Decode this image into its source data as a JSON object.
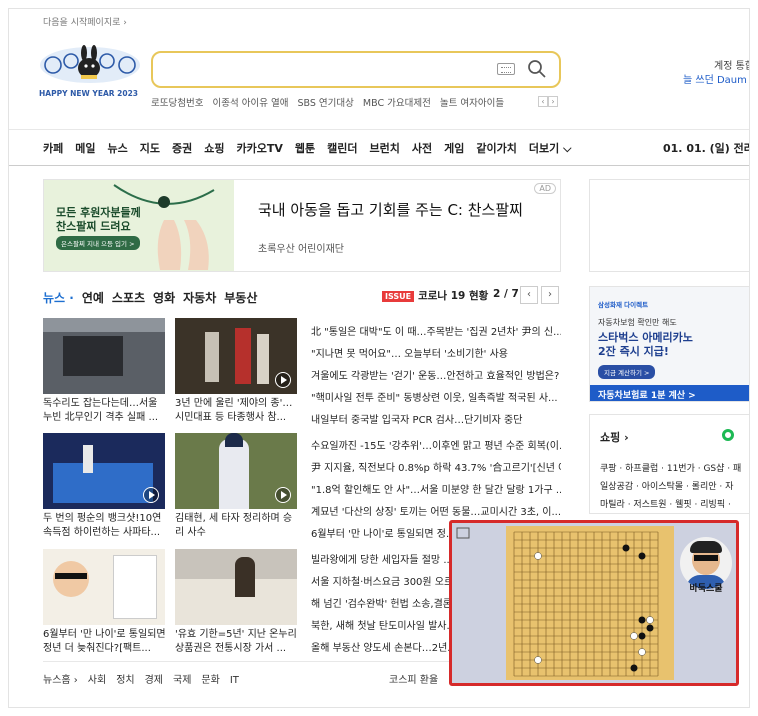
{
  "top": {
    "startpage": "다음을 시작페이지로 ›"
  },
  "logo": {
    "text": "HAPPY NEW YEAR 2023"
  },
  "search": {
    "placeholder": ""
  },
  "hot_keywords": [
    "로또당첨번호",
    "이종석 아이유 열애",
    "SBS 연기대상",
    "MBC 가요대제전",
    "놀트 여자아이들"
  ],
  "account": {
    "line1": "계정 통합",
    "line2": "늘 쓰던 Daum 계정"
  },
  "gnb": [
    "카페",
    "메일",
    "뉴스",
    "지도",
    "증권",
    "쇼핑",
    "카카오TV",
    "웹툰",
    "캘린더",
    "브런치",
    "사전",
    "게임",
    "같이가치",
    "더보기 ⌵"
  ],
  "date": "01. 01. (일)  전라",
  "ad": {
    "image_text_1": "모든 후원자분들께",
    "image_text_2": "찬스팔찌 드려요",
    "image_button": "은스팔찌 지내 으등 입기 >",
    "title": "국내 아동을 돕고 기회를 주는 C: 찬스팔찌",
    "sub": "초록우산 어린이재단",
    "badge": "AD"
  },
  "news_tabs": {
    "active": "뉴스 ·",
    "items": [
      "연예",
      "스포츠",
      "영화",
      "자동차",
      "부동산"
    ]
  },
  "issue": {
    "badge": "ISSUE",
    "text": "코로나 19 현황"
  },
  "pager": {
    "text": "2 / 7",
    "prev": "‹",
    "next": "›"
  },
  "cards": [
    {
      "caption": "독수리도 잡는다는데…서울 누빈 北무인기 격추 실패 ..."
    },
    {
      "caption": "3년 만에 울린 '제야의 종'… 시민대표 등 타종행사 참..."
    },
    {
      "caption": "두 번의 펑순의 뱅크샷!10연속득점 하이런하는 사파타..."
    },
    {
      "caption": "김태현, 세 타자 정리하며 승리 사수"
    },
    {
      "caption": "6월부터 '만 나이'로 통일되면 정년 더 늦춰진다?[팩트..."
    },
    {
      "caption": "'유효 기한=5년' 지난 온누리 상품권은 전통시장 가서 ..."
    }
  ],
  "headlines": [
    "北 \"통일은 대박\"도 이 때…주목받는 '집권 2년차' 尹의 신...",
    "\"지나면 못 먹어요\"… 오늘부터 '소비기한' 사용",
    "겨울에도 각광받는 '걷기' 운동…안전하고 효율적인 방법은?",
    "\"핵미사일 전투 준비\" 동병상련 이웃, 일촉즉발 적국된 사...",
    "내일부터 중국발 입국자 PCR 검사…단기비자 중단",
    "수요일까진 -15도 '강추위'…이후엔 맑고 평년 수준 회복(이...",
    "尹 지지율, 직전보다 0.8%p 하락 43.7% '合고르기'[신년 여...",
    "\"1.8억 할인해도 안 사\"…서울 미분양 한 달간 달랑 1가구 ...",
    "계묘년 '다산의 상징' 토끼는 어떤 동물…교미시간 3초, 이...",
    "6월부터 '만 나이'로 통일되면 정...",
    "빌라왕에게 당한 세입자들 절망 ...",
    "서울 지하철·버스요금 300원 오르...",
    "해 넘긴 '검수완박' 헌법 소송,결론...",
    "북한, 새해 첫날 탄도미사일 발사...",
    "올해 부동산 양도세 손본다…2년..."
  ],
  "side_ad": {
    "line1": "삼성화재 다이렉트",
    "line2": "자동차보험 확인만 해도",
    "line3": "스타벅스 아메리카노",
    "line4": "2잔 즉시 지급!",
    "button": "지금 계산하기 >",
    "footer": "자동차보험료 1분 계산 >"
  },
  "shopping": {
    "title": "쇼핑 ›",
    "lines": [
      "쿠팡 · 하프클럽 · 11번가 · GS샵 · 패",
      "일상공감 · 아이스탁몰 · 롤리안 · 자",
      "마틸라 · 저스트원 · 웰핏 · 리빙픽 ·"
    ]
  },
  "news_footer": {
    "items": [
      "뉴스홈 ›",
      "사회",
      "정치",
      "경제",
      "국제",
      "문화",
      "IT"
    ],
    "right": "코스피  환율"
  },
  "pip": {
    "label": "바둑스쿨"
  },
  "colors": {
    "accent": "#1e6fd0",
    "issue": "#e83b3b",
    "pip_border": "#d62a2a",
    "board": "#e8c26e"
  }
}
